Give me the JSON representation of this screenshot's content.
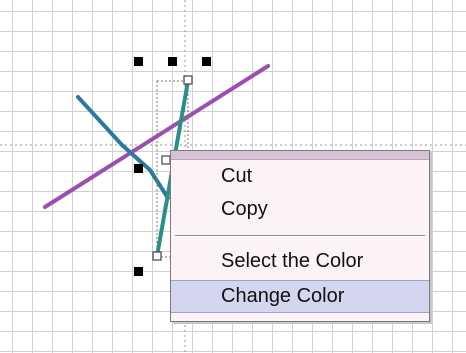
{
  "context_menu": {
    "items": [
      {
        "label": "Cut"
      },
      {
        "label": "Copy"
      },
      {
        "label": "Select the Color"
      },
      {
        "label": "Change Color",
        "highlighted": true
      }
    ]
  },
  "colors": {
    "purple_line": "#9b4fae",
    "blue_line": "#2a7aa0",
    "teal_line": "#2a8f88",
    "grid": "#d0d0d0",
    "guide_line": "#9a9a9a",
    "menu_background": "#fdf3f7",
    "menu_highlight": "#d3d6ee"
  },
  "icons": {
    "selection_handles": "square-handle-icon",
    "endpoint_handles": "hollow-square-handle-icon"
  }
}
